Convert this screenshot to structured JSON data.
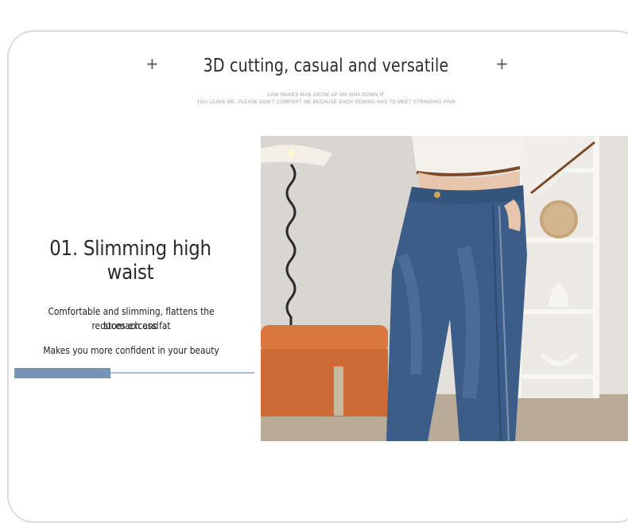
{
  "header": {
    "title": "3D cutting, casual and versatile",
    "subtitle_line1": "LOW MAKES MAN GROW UP ON SINA DOWN IF",
    "subtitle_line2": "YOU LEAVE ME, PLEASE DON'T COMFORT ME BECAUSE EACH SEWING HAS TO MEET STRINGING PAIN",
    "plus_left": "+",
    "plus_right": "+"
  },
  "feature": {
    "title": "01. Slimming high waist",
    "desc_line1": "Comfortable and slimming, flattens the stomach and",
    "desc_line2": "reduces excess fat",
    "desc_line3": "Makes you more confident in your beauty"
  },
  "progress": {
    "value": 0.4
  },
  "colors": {
    "accent": "#7893b8",
    "track": "#aab9cf",
    "bench": "#d9773f",
    "denim": "#3c5d87"
  }
}
